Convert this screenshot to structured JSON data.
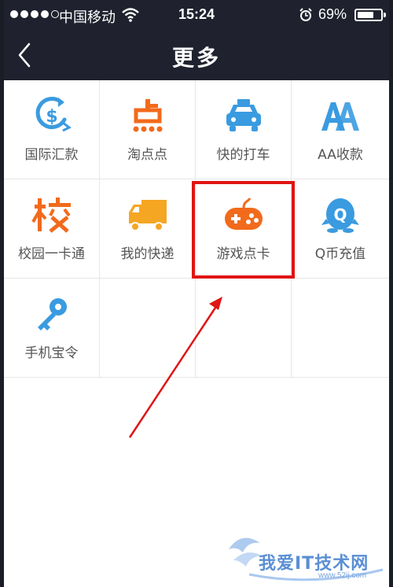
{
  "status_bar": {
    "carrier": "中国移动",
    "time": "15:24",
    "battery_percent": "69%",
    "battery_level": 0.69,
    "signal_bars_filled": 4
  },
  "nav": {
    "title": "更多",
    "back_icon": "chevron-left-icon"
  },
  "grid": {
    "items": [
      {
        "label": "国际汇款",
        "icon": "currency-exchange-icon",
        "color": "#3a9be0"
      },
      {
        "label": "淘点点",
        "icon": "taodiandian-icon",
        "color": "#f26a1b"
      },
      {
        "label": "快的打车",
        "icon": "taxi-icon",
        "color": "#3a9be0"
      },
      {
        "label": "AA收款",
        "icon": "aa-icon",
        "color": "#3a9be0"
      },
      {
        "label": "校园一卡通",
        "icon": "campus-card-icon",
        "color": "#f26a1b"
      },
      {
        "label": "我的快递",
        "icon": "delivery-truck-icon",
        "color": "#f5a623"
      },
      {
        "label": "游戏点卡",
        "icon": "gamepad-icon",
        "color": "#f26a1b"
      },
      {
        "label": "Q币充值",
        "icon": "qq-penguin-icon",
        "color": "#3a9be0"
      },
      {
        "label": "手机宝令",
        "icon": "key-icon",
        "color": "#3a9be0"
      }
    ]
  },
  "annotation": {
    "highlight_color": "#e01515",
    "highlighted_item": "游戏点卡"
  },
  "watermark": {
    "text": "我爱IT技术网",
    "site": "www.52ij.com"
  }
}
